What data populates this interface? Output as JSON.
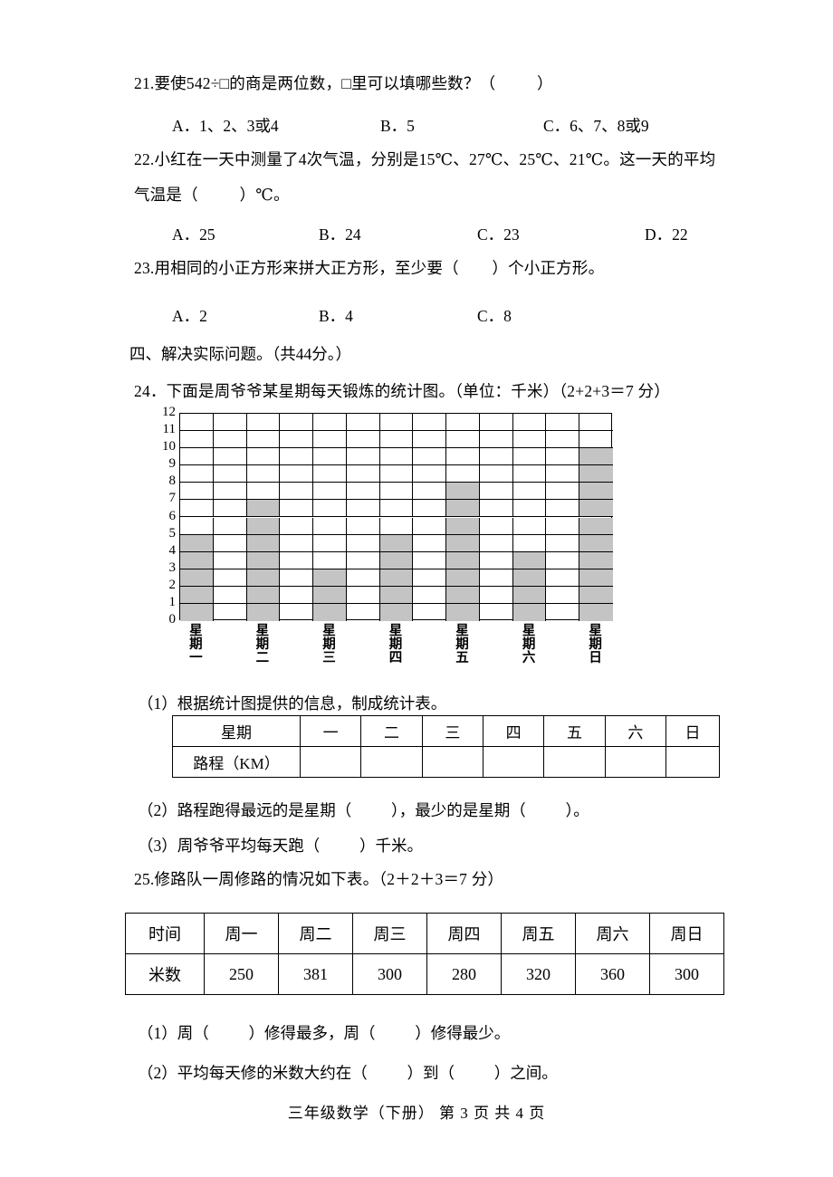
{
  "questions": {
    "q21": {
      "stem": "21.要使542÷□的商是两位数，□里可以填哪些数？（          ）",
      "options": [
        "A．1、2、3或4",
        "B．5",
        "C．6、7、8或9"
      ]
    },
    "q22": {
      "stem_line1": "22.小红在一天中测量了4次气温，分别是15℃、27℃、25℃、21℃。这一天的平均",
      "stem_line2": "气温是（          ）℃。",
      "options": [
        "A．25",
        "B．24",
        "C．23",
        "D．22"
      ]
    },
    "q23": {
      "stem": "23.用相同的小正方形来拼大正方形，至少要（        ）个小正方形。",
      "options": [
        "A．2",
        "B．4",
        "C．8"
      ]
    },
    "section4": "四、解决实际问题。（共44分。）",
    "q24": {
      "stem": "24．下面是周爷爷某星期每天锻炼的统计图。（单位：千米）（2+2+3＝7 分）",
      "sub1": "（1）根据统计图提供的信息，制成统计表。",
      "sub2": "（2）路程跑得最远的是星期（          ），最少的是星期（          ）。",
      "sub3": "（3）周爷爷平均每天跑（          ）千米。",
      "table": {
        "row_header": [
          "星期",
          "路程（KM）"
        ],
        "days": [
          "一",
          "二",
          "三",
          "四",
          "五",
          "六",
          "日"
        ],
        "values": [
          "",
          "",
          "",
          "",
          "",
          "",
          ""
        ]
      }
    },
    "q25": {
      "stem": "25.修路队一周修路的情况如下表。（2＋2＋3＝7 分）",
      "sub1": "（1）周（          ）修得最多，周（          ）修得最少。",
      "sub2": "（2）平均每天修的米数大约在（          ）到（          ）之间。",
      "table": {
        "row_header": [
          "时间",
          "米数"
        ],
        "days": [
          "周一",
          "周二",
          "周三",
          "周四",
          "周五",
          "周六",
          "周日"
        ],
        "values": [
          "250",
          "381",
          "300",
          "280",
          "320",
          "360",
          "300"
        ]
      }
    }
  },
  "footer": "三年级数学（下册） 第 3 页 共 4 页",
  "chart_data": {
    "type": "bar",
    "title": "周爷爷某星期每天锻炼的统计图",
    "unit": "千米",
    "categories": [
      "星期一",
      "星期二",
      "星期三",
      "星期四",
      "星期五",
      "星期六",
      "星期日"
    ],
    "values": [
      5,
      7,
      3,
      5,
      8,
      4,
      10
    ],
    "xlabel": "",
    "ylabel": "",
    "ylim": [
      0,
      12
    ],
    "yticks": [
      0,
      1,
      2,
      3,
      4,
      5,
      6,
      7,
      8,
      9,
      10,
      11,
      12
    ],
    "grid": true,
    "legend": "none",
    "bar_color": "#c4c4c4",
    "grid_columns": 13,
    "grid_rows": 12
  }
}
